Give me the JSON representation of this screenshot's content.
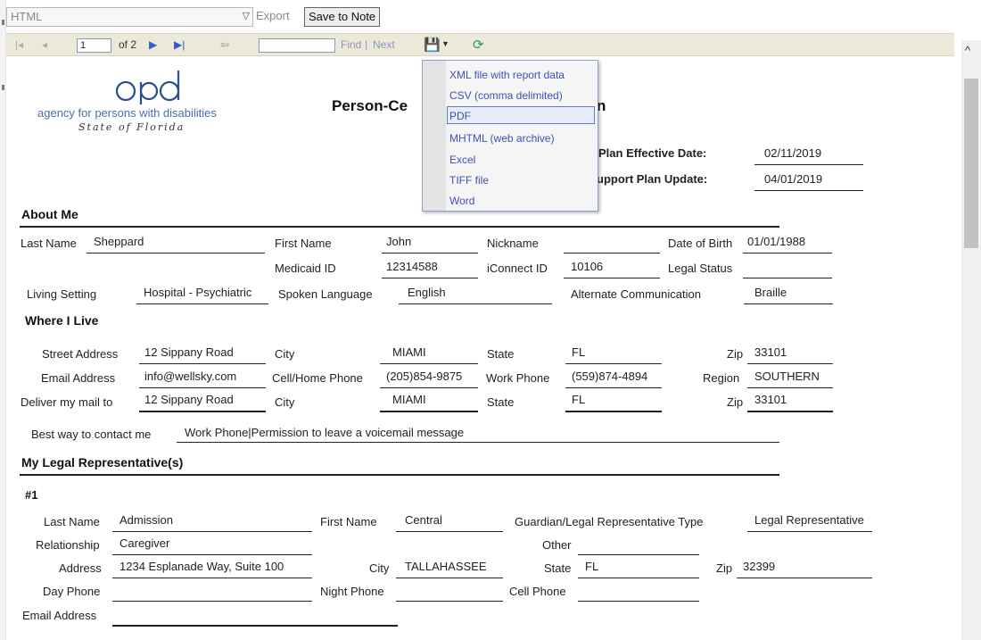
{
  "topbar": {
    "format_value": "HTML",
    "export_label": "Export",
    "save_note_label": "Save to Note"
  },
  "toolbar": {
    "first_icon": "first-page-icon",
    "prev_icon": "prev-page-icon",
    "page_value": "1",
    "page_of": "of 2",
    "next_icon": "next-page-icon",
    "last_icon": "last-page-icon",
    "back_icon": "back-icon",
    "find_label": "Find",
    "separator": "|",
    "next_label": "Next",
    "export_icon": "save-disk-icon",
    "refresh_icon": "refresh-icon"
  },
  "export_menu": {
    "items": [
      "XML file with report data",
      "CSV (comma delimited)",
      "PDF",
      "MHTML (web archive)",
      "Excel",
      "TIFF file",
      "Word"
    ]
  },
  "logo": {
    "org_line": "agency for persons with disabilities",
    "state_line": "State of Florida"
  },
  "report": {
    "title": "Person-Ce",
    "title_tail": "n",
    "effective_label": "Plan Effective Date:",
    "effective_value": "02/11/2019",
    "update_label": "upport Plan Update:",
    "update_value": "04/01/2019"
  },
  "about": {
    "heading": "About Me",
    "last_name_label": "Last Name",
    "last_name": "Sheppard",
    "first_name_label": "First Name",
    "first_name": "John",
    "nickname_label": "Nickname",
    "nickname": "",
    "dob_label": "Date of Birth",
    "dob": "01/01/1988",
    "medicaid_label": "Medicaid ID",
    "medicaid": "12314588",
    "iconnect_label": "iConnect ID",
    "iconnect": "10106",
    "legal_status_label": "Legal Status",
    "legal_status": "",
    "living_label": "Living Setting",
    "living": "Hospital - Psychiatric",
    "language_label": "Spoken Language",
    "language": "English",
    "alt_comm_label": "Alternate Communication",
    "alt_comm": "Braille"
  },
  "where": {
    "heading": "Where I Live",
    "street_label": "Street Address",
    "street": "12 Sippany Road",
    "city_label": "City",
    "city": "MIAMI",
    "state_label": "State",
    "state": "FL",
    "zip_label": "Zip",
    "zip": "33101",
    "email_label": "Email Address",
    "email": "info@wellsky.com",
    "cell_label": "Cell/Home Phone",
    "cell": "(205)854-9875",
    "work_label": "Work Phone",
    "work": "(559)874-4894",
    "region_label": "Region",
    "region": "SOUTHERN",
    "mail_label": "Deliver my mail to",
    "mail_street": "12 Sippany Road",
    "mail_city_label": "City",
    "mail_city": "MIAMI",
    "mail_state_label": "State",
    "mail_state": "FL",
    "mail_zip_label": "Zip",
    "mail_zip": "33101",
    "contact_label": "Best way to contact me",
    "contact": "Work Phone|Permission to leave a voicemail message"
  },
  "legal": {
    "heading": "My Legal Representative(s)",
    "number": "#1",
    "last_name_label": "Last Name",
    "last_name": "Admission",
    "first_name_label": "First Name",
    "first_name": "Central",
    "type_label": "Guardian/Legal Representative Type",
    "type": "Legal Representative",
    "relationship_label": "Relationship",
    "relationship": "Caregiver",
    "other_label": "Other",
    "other": "",
    "address_label": "Address",
    "address": "1234 Esplanade Way, Suite 100",
    "city_label": "City",
    "city": "TALLAHASSEE",
    "state_label": "State",
    "state": "FL",
    "zip_label": "Zip",
    "zip": "32399",
    "day_label": "Day Phone",
    "day": "",
    "night_label": "Night Phone",
    "night": "",
    "cell_label": "Cell Phone",
    "cell": "",
    "email_label": "Email Address",
    "email": ""
  }
}
